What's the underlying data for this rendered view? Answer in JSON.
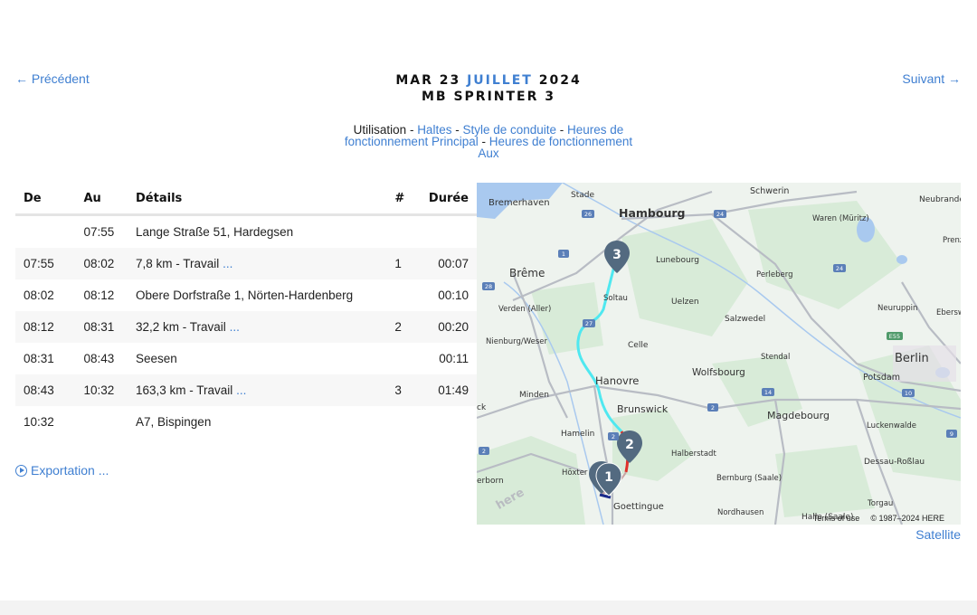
{
  "nav": {
    "prev": "← Précédent",
    "next": "Suivant →"
  },
  "header": {
    "day": "MAR 23",
    "month": "JUILLET",
    "year": "2024",
    "vehicle": "MB SPRINTER 3"
  },
  "subnav": {
    "current": "Utilisation",
    "sep": " - ",
    "links": [
      "Haltes",
      "Style de conduite",
      "Heures de fonctionnement Principal",
      "Heures de fonctionnement Aux"
    ]
  },
  "table": {
    "headers": {
      "de": "De",
      "au": "Au",
      "details": "Détails",
      "num": "#",
      "duree": "Durée"
    },
    "rows": [
      {
        "de": "",
        "au": "07:55",
        "details": "Lange Straße 51, Hardegsen",
        "more": "",
        "num": "",
        "duree": ""
      },
      {
        "de": "07:55",
        "au": "08:02",
        "details": "7,8 km - Travail",
        "more": "...",
        "num": "1",
        "duree": "00:07"
      },
      {
        "de": "08:02",
        "au": "08:12",
        "details": "Obere Dorfstraße 1, Nörten-Hardenberg",
        "more": "",
        "num": "",
        "duree": "00:10"
      },
      {
        "de": "08:12",
        "au": "08:31",
        "details": "32,2 km - Travail",
        "more": "...",
        "num": "2",
        "duree": "00:20"
      },
      {
        "de": "08:31",
        "au": "08:43",
        "details": "Seesen",
        "more": "",
        "num": "",
        "duree": "00:11"
      },
      {
        "de": "08:43",
        "au": "10:32",
        "details": "163,3 km - Travail",
        "more": "...",
        "num": "3",
        "duree": "01:49"
      },
      {
        "de": "10:32",
        "au": "",
        "details": "A7, Bispingen",
        "more": "",
        "num": "",
        "duree": ""
      }
    ]
  },
  "export_label": "Exportation ...",
  "map": {
    "cities": {
      "stade": "Stade",
      "bremerhaven": "Bremerhaven",
      "hambourg": "Hambourg",
      "schwerin": "Schwerin",
      "neubrande": "Neubrande",
      "waren": "Waren (Müritz)",
      "prenz": "Prenz",
      "lunebourg": "Lunebourg",
      "breme": "Brême",
      "perleberg": "Perleberg",
      "soltau": "Soltau",
      "uelzen": "Uelzen",
      "verden": "Verden (Aller)",
      "salzwedel": "Salzwedel",
      "neuruppin": "Neuruppin",
      "eberswald": "Eberswald",
      "nienburg": "Nienburg/Weser",
      "celle": "Celle",
      "stendal": "Stendal",
      "berlin": "Berlin",
      "hanovre": "Hanovre",
      "wolfsbourg": "Wolfsbourg",
      "potsdam": "Potsdam",
      "minden": "Minden",
      "brunswick": "Brunswick",
      "magdebourg": "Magdebourg",
      "hamelin": "Hamelin",
      "luckenwalde": "Luckenwalde",
      "halberstadt": "Halberstadt",
      "dessau": "Dessau-Roßlau",
      "hoxter": "Höxter",
      "bernburg": "Bernburg (Saale)",
      "erborn": "erborn",
      "goettingue": "Goettingue",
      "nordhausen": "Nordhausen",
      "torgau": "Torgau",
      "halle": "Halle (Saale)",
      "ck": "ck"
    },
    "roads": [
      "26",
      "24",
      "1",
      "28",
      "27",
      "24",
      "E55",
      "2",
      "2",
      "14",
      "10",
      "9",
      "2"
    ],
    "markers": [
      "3",
      "2",
      "1"
    ],
    "watermark": "here",
    "terms": "Terms of use",
    "copyright": "© 1987–2024 HERE"
  },
  "satellite_label": "Satellite",
  "colors": {
    "accent": "#3f7fd1",
    "route_main": "#4fe8f0",
    "route_segment2": "#e0302a",
    "route_segment1": "#1a2a8a",
    "marker": "#536a80"
  }
}
